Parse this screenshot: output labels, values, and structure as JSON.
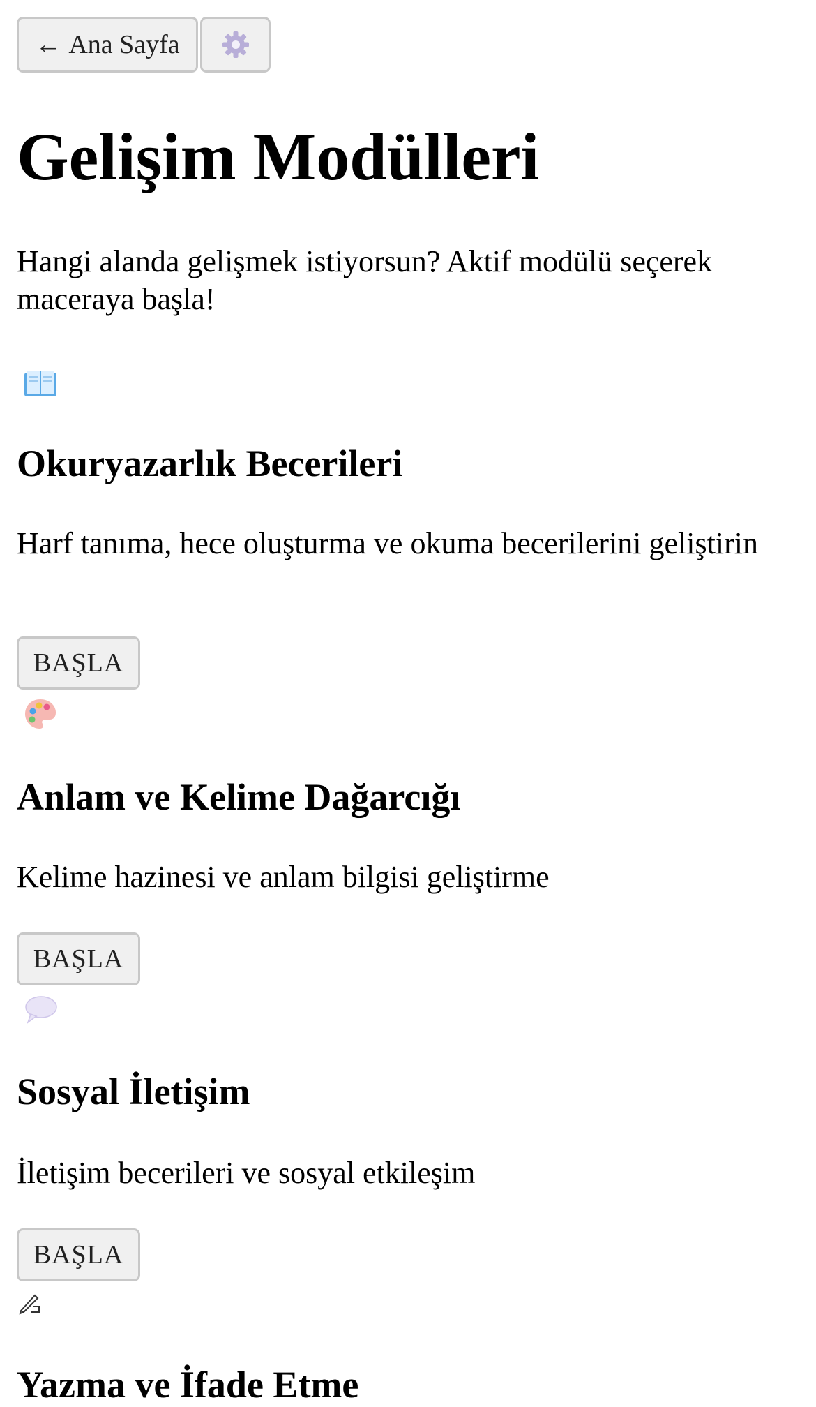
{
  "nav": {
    "back_arrow": "←",
    "back_label": "Ana Sayfa",
    "settings_icon": "gear-icon"
  },
  "page": {
    "title": "Gelişim Modülleri",
    "intro": "Hangi alanda gelişmek istiyorsun? Aktif modülü seçerek maceraya başla!"
  },
  "modules": [
    {
      "icon": "open-book-icon",
      "title": "Okuryazarlık Becerileri",
      "description": "Harf tanıma, hece oluşturma ve okuma becerilerini geliştirin",
      "button": "BAŞLA"
    },
    {
      "icon": "palette-icon",
      "title": "Anlam ve Kelime Dağarcığı",
      "description": "Kelime hazinesi ve anlam bilgisi geliştirme",
      "button": "BAŞLA"
    },
    {
      "icon": "speech-bubble-icon",
      "title": "Sosyal İletişim",
      "description": "İletişim becerileri ve sosyal etkileşim",
      "button": "BAŞLA"
    },
    {
      "icon": "writing-hand-icon",
      "title": "Yazma ve İfade Etme"
    }
  ],
  "colors": {
    "button_bg": "#f0f0f0",
    "button_border": "#c8c8c8",
    "gear": "#b8aed8",
    "book_page": "#dcefff",
    "book_edge": "#5aa9e6",
    "bubble": "#e9e4f7"
  }
}
